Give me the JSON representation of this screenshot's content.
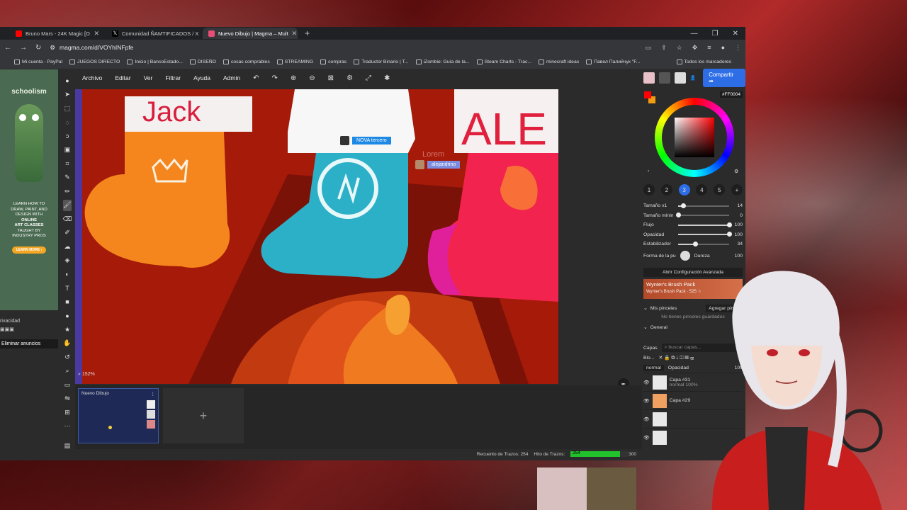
{
  "browser": {
    "tabs": [
      {
        "label": "Bruno Mars - 24K Magic [O",
        "color": "#ff0000"
      },
      {
        "label": "Comunidad ÑAMTIFICADOS / X",
        "color": "#000000"
      },
      {
        "label": "Nuevo Dibujo | Magma – Mult",
        "color": "#e94e77",
        "active": true
      }
    ],
    "url": "magma.com/d/VOYhINFpfe",
    "bookmarks": [
      "Mi cuenta - PayPal",
      "JUEGOS DIRECTO",
      "Inicio | BancoEstado...",
      "DISEÑO",
      "cosas comprables",
      "STREAMING",
      "compras",
      "Traductor Binario | T...",
      "iZombie: Guía de la...",
      "Steam Charts - Trac...",
      "minecraft ideas",
      "Павел Палийчук \"F..."
    ],
    "bookmarks_right": "Todos los marcadores"
  },
  "ad": {
    "brand": "schoolism",
    "text_lines": [
      "LEARN HOW TO",
      "DRAW, PAINT, AND",
      "DESIGN WITH",
      "ONLINE",
      "ART CLASSES",
      "TAUGHT BY",
      "INDUSTRY PROS"
    ],
    "button": "LEARN MORE ›",
    "privacy": "rivacidad",
    "remove": "Eliminar anuncios"
  },
  "menu": {
    "items": [
      "Archivo",
      "Editar",
      "Ver",
      "Filtrar",
      "Ayuda",
      "Admin"
    ]
  },
  "canvas": {
    "zoom": "152%",
    "cursors": [
      {
        "name": "NOVA tercero",
        "color": "#1e88e5"
      },
      {
        "name": "alejandrino",
        "color": "#7b8cde"
      }
    ],
    "faded_label": "Lorem"
  },
  "strip": {
    "doc_title": "Nuevo Dibujo",
    "add": "+"
  },
  "status": {
    "strokes_label": "Recuento de Trazos: 254",
    "hit_label": "Hito de Trazos:",
    "hit_value": "254",
    "hit_max": "300",
    "hit_progress": 0.847
  },
  "side": {
    "share": "Compartir",
    "hex": "FF0004",
    "primary_color": "#ff0004",
    "secondary_color": "#f39c12",
    "brush_slots": [
      "1",
      "2",
      "3",
      "4",
      "5",
      "6",
      "+"
    ],
    "sliders": [
      {
        "label": "Tamaño x1",
        "value": "14",
        "pos": 0.1
      },
      {
        "label": "Tamaño mínimo",
        "value": "0",
        "pos": 0.0
      },
      {
        "label": "Flujo",
        "value": "100",
        "pos": 1.0
      },
      {
        "label": "Opacidad",
        "value": "100",
        "pos": 1.0
      },
      {
        "label": "Estabilizador",
        "value": "34",
        "pos": 0.34
      }
    ],
    "shape_label": "Forma de la pu",
    "hardness_label": "Dureza",
    "hardness_value": "100",
    "advanced": "Abrir Configuración Avanzada",
    "pack_title": "Wynter's Brush Pack",
    "pack_sub": "Wynter's Brush Pack · 525 ☆",
    "my_brushes": "Mis pinceles",
    "add_brush": "Agregar pincel",
    "no_brushes": "No tienes pinceles guardados",
    "general": "General",
    "layers_label": "Capas",
    "layers_search": "buscar capas...",
    "blend": "normal",
    "opacity_label": "Opacidad",
    "opacity_value": "100",
    "blo_label": "Blo...",
    "layers": [
      {
        "name": "Capa #31",
        "sub": "normal 100%"
      },
      {
        "name": "Capa #29",
        "sub": ""
      },
      {
        "name": "",
        "sub": ""
      },
      {
        "name": "",
        "sub": ""
      }
    ]
  }
}
